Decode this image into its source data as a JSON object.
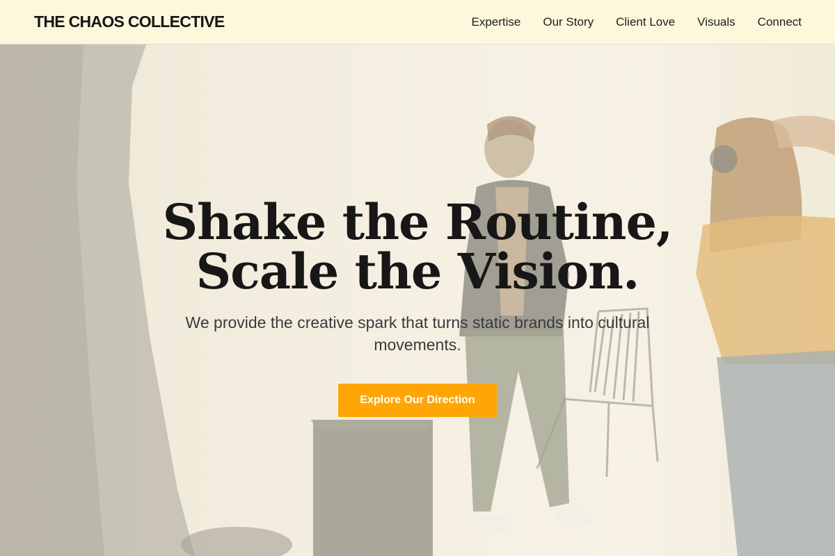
{
  "header": {
    "brand": "THE CHAOS COLLECTIVE",
    "nav": [
      "Expertise",
      "Our Story",
      "Client Love",
      "Visuals",
      "Connect"
    ]
  },
  "hero": {
    "headline": "Shake the Routine, Scale the Vision.",
    "subheadline": "We provide the creative spark that turns static brands into cultural movements.",
    "cta_label": "Explore Our Direction"
  },
  "colors": {
    "header_bg": "#fdf7dc",
    "accent": "#ffa606",
    "text_dark": "#171717"
  }
}
